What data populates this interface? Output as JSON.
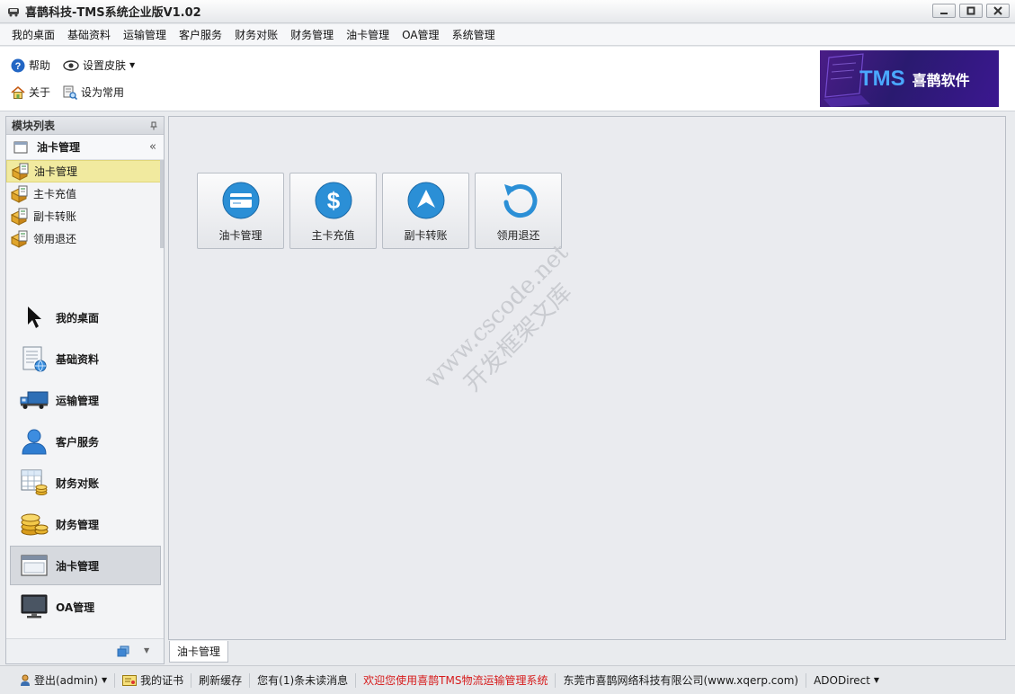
{
  "window": {
    "title": "喜鹊科技-TMS系统企业版V1.02"
  },
  "menu": [
    "我的桌面",
    "基础资料",
    "运输管理",
    "客户服务",
    "财务对账",
    "财务管理",
    "油卡管理",
    "OA管理",
    "系统管理"
  ],
  "toolbar": {
    "help": "帮助",
    "skin": "设置皮肤",
    "about": "关于",
    "set_common": "设为常用"
  },
  "banner": {
    "brand": "TMS",
    "name": "喜鹊软件"
  },
  "sidebar": {
    "panel_title": "模块列表",
    "group_title": "油卡管理",
    "modules": [
      "油卡管理",
      "主卡充值",
      "副卡转账",
      "领用退还"
    ],
    "nav": [
      "我的桌面",
      "基础资料",
      "运输管理",
      "客户服务",
      "财务对账",
      "财务管理",
      "油卡管理",
      "OA管理"
    ]
  },
  "tiles": [
    {
      "label": "油卡管理",
      "icon": "card-icon"
    },
    {
      "label": "主卡充值",
      "icon": "dollar-icon"
    },
    {
      "label": "副卡转账",
      "icon": "arrow-up-icon"
    },
    {
      "label": "领用退还",
      "icon": "refresh-icon"
    }
  ],
  "watermark": {
    "line1": "www.cscode.net",
    "line2": "开发框架文库"
  },
  "doc_tab": "油卡管理",
  "status": {
    "logout": "登出(admin)",
    "cert": "我的证书",
    "refresh": "刷新缓存",
    "messages": "您有(1)条未读消息",
    "welcome": "欢迎您使用喜鹊TMS物流运输管理系统",
    "company": "东莞市喜鹊网络科技有限公司(www.xqerp.com)",
    "db": "ADODirect"
  },
  "colors": {
    "tile_icon": "#2b8fd6",
    "active_module": "#f1ea9f",
    "welcome_text": "#d61a1a"
  }
}
